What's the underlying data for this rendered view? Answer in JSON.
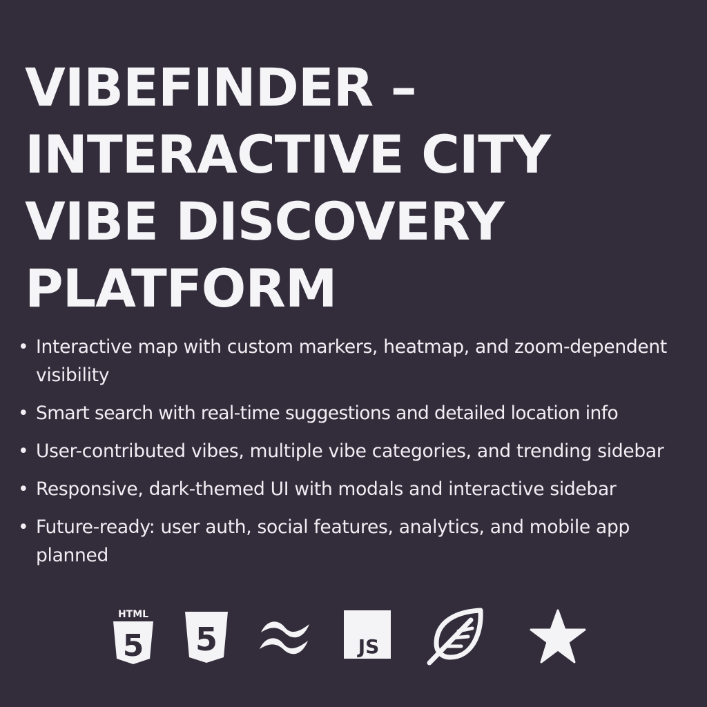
{
  "title": {
    "line1": "VIBEFINDER –",
    "line2": "INTERACTIVE CITY",
    "line3": "VIBE DISCOVERY",
    "line4": "PLATFORM"
  },
  "features": [
    {
      "bullet": "•",
      "text": "Interactive map with custom markers, heatmap, and zoom-dependent visibility"
    },
    {
      "bullet": "•",
      "text": "Smart search with real-time suggestions and detailed location info"
    },
    {
      "bullet": "•",
      "text": "User-contributed vibes, multiple vibe categories, and trending sidebar"
    },
    {
      "bullet": "•",
      "text": "Responsive, dark-themed UI with modals and interactive sidebar"
    },
    {
      "bullet": "•",
      "text": "Future-ready: user auth, social features, analytics, and mobile app planned"
    }
  ],
  "tech_icons": {
    "html5": {
      "label": "HTML",
      "glyph": "5",
      "icon": "html5-icon"
    },
    "css3": {
      "glyph": "5",
      "icon": "css3-shield-icon"
    },
    "tailwind": {
      "icon": "tailwind-wave-icon"
    },
    "js": {
      "label": "JS",
      "icon": "javascript-icon"
    },
    "leaf": {
      "icon": "leaf-icon"
    },
    "star": {
      "icon": "star-icon"
    }
  },
  "colors": {
    "background": "#332d3b",
    "foreground": "#f4f3f6"
  }
}
